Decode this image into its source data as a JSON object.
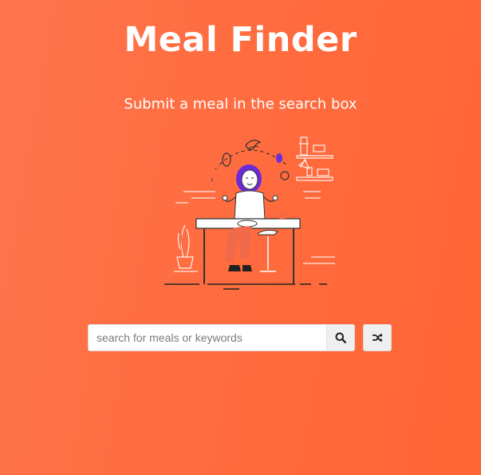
{
  "header": {
    "title": "Meal Finder",
    "subtitle": "Submit a meal in the search box"
  },
  "illustration": {
    "icon": "person-eating-illustration"
  },
  "search": {
    "value": "",
    "placeholder": "search for meals or keywords",
    "search_icon": "search-icon",
    "random_icon": "shuffle-icon"
  },
  "colors": {
    "background_start": "#ff744c",
    "background_end": "#ff6535",
    "accent_purple": "#6a2bd9",
    "accent_coral": "#f06a4a",
    "button_bg": "#efefef"
  }
}
